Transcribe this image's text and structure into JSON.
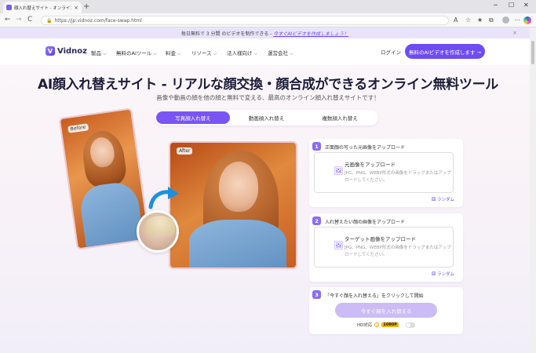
{
  "browser": {
    "tab_title": "顔入れ替えサイト - オンラインで無料に",
    "tab_close": "×",
    "new_tab": "+",
    "url": "https://jp.vidnoz.com/face-swap.html",
    "win_min": "─",
    "win_max": "☐",
    "win_close": "✕",
    "back": "←",
    "forward": "→",
    "reload": "C"
  },
  "promo": {
    "text": "毎日無料で 3 分間 のビデオを制作できる -",
    "link": "今すぐAIビデオを作成しましょう！",
    "close": "×"
  },
  "header": {
    "logo": "Vidnoz",
    "logo_mark": "V",
    "menu": [
      {
        "label": "製品"
      },
      {
        "label": "無料のAIツール"
      },
      {
        "label": "料金"
      },
      {
        "label": "リソース"
      },
      {
        "label": "法人様向け"
      },
      {
        "label": "運営会社"
      }
    ],
    "chevron": "⌵",
    "login": "ログイン",
    "cta": "無料のAIビデオを作成します →"
  },
  "hero": {
    "title": "AI顔入れ替えサイト - リアルな顔交換・顔合成ができるオンライン無料ツール",
    "subtitle": "画像や動画の顔を他の顔と無料で変える、最高のオンライン顔入れ替えサイトです！",
    "tabs": [
      {
        "label": "写真顔入れ替え",
        "active": true
      },
      {
        "label": "動画顔入れ替え",
        "active": false
      },
      {
        "label": "複数顔入れ替え",
        "active": false
      }
    ],
    "before_label": "Before",
    "after_label": "After"
  },
  "steps": [
    {
      "num": "1",
      "title": "正面顔の写った元画像をアップロード",
      "upload_label": "元画像をアップロード",
      "upload_hint": "JPG、PNG、WEBP形式の画像をドラッグまたはアップロードしてください。",
      "random": "ランダム"
    },
    {
      "num": "2",
      "title": "入れ替えたい顔の画像をアップロード",
      "upload_label": "ターゲット画像をアップロード",
      "upload_hint": "JPG、PNG、WEBP形式の画像をドラッグまたはアップロードしてください。",
      "random": "ランダム"
    },
    {
      "num": "3",
      "title": "「今すぐ顔を入れ替える」をクリックして開始",
      "button": "今すぐ顔を入れ替える",
      "hd_label": "HD対応",
      "hd_badge": "1080P"
    }
  ]
}
